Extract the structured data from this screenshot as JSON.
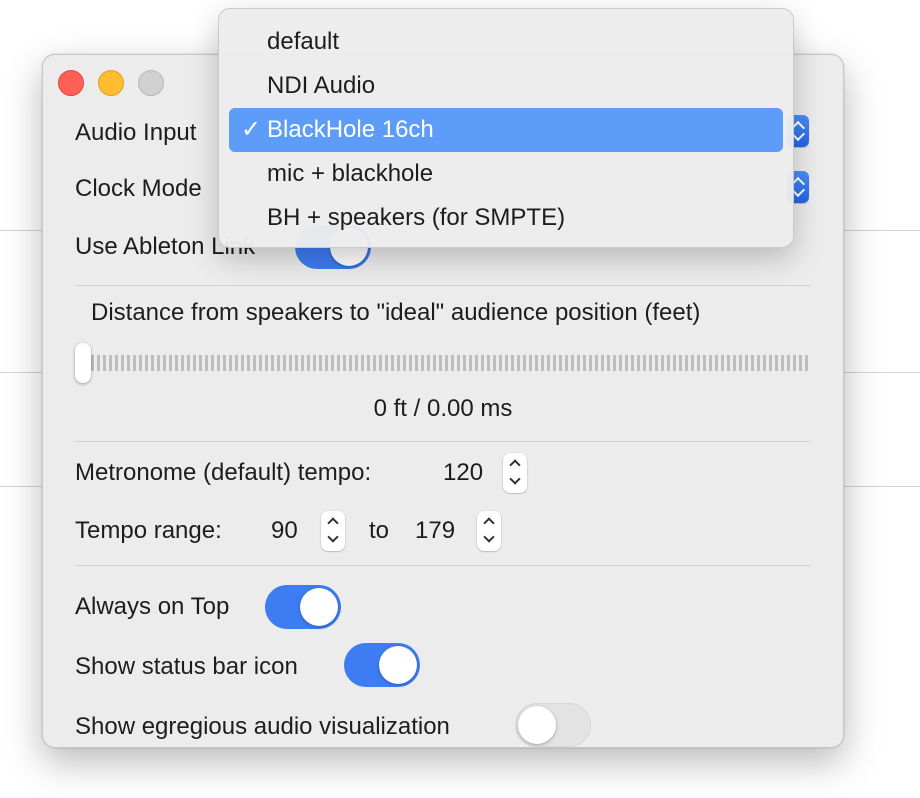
{
  "window": {
    "audio_input_label": "Audio Input",
    "clock_mode_label": "Clock Mode",
    "ableton_link_label": "Use Ableton Link",
    "distance_label": "Distance from speakers to \"ideal\" audience position (feet)",
    "distance_value": "0 ft / 0.00 ms",
    "distance_slider_fraction": 0,
    "metronome_label": "Metronome (default) tempo:",
    "metronome_value": "120",
    "tempo_range_label": "Tempo range:",
    "tempo_range_min": "90",
    "tempo_range_to": "to",
    "tempo_range_max": "179",
    "always_on_top_label": "Always on Top",
    "always_on_top": true,
    "status_bar_icon_label": "Show status bar icon",
    "status_bar_icon": true,
    "egregious_viz_label": "Show egregious audio visualization",
    "egregious_viz": false,
    "ableton_link": true
  },
  "audio_input_menu": {
    "items": [
      {
        "label": "default",
        "selected": false
      },
      {
        "label": "NDI Audio",
        "selected": false
      },
      {
        "label": "BlackHole 16ch",
        "selected": true
      },
      {
        "label": "mic + blackhole",
        "selected": false
      },
      {
        "label": "BH + speakers (for SMPTE)",
        "selected": false
      }
    ],
    "check_mark": "✓"
  },
  "colors": {
    "accent": "#3d7cf3",
    "menu_highlight": "#5d9cf8",
    "close": "#fe5f57",
    "minimize": "#febc2e",
    "zoom_disabled": "#d0d0d0"
  }
}
